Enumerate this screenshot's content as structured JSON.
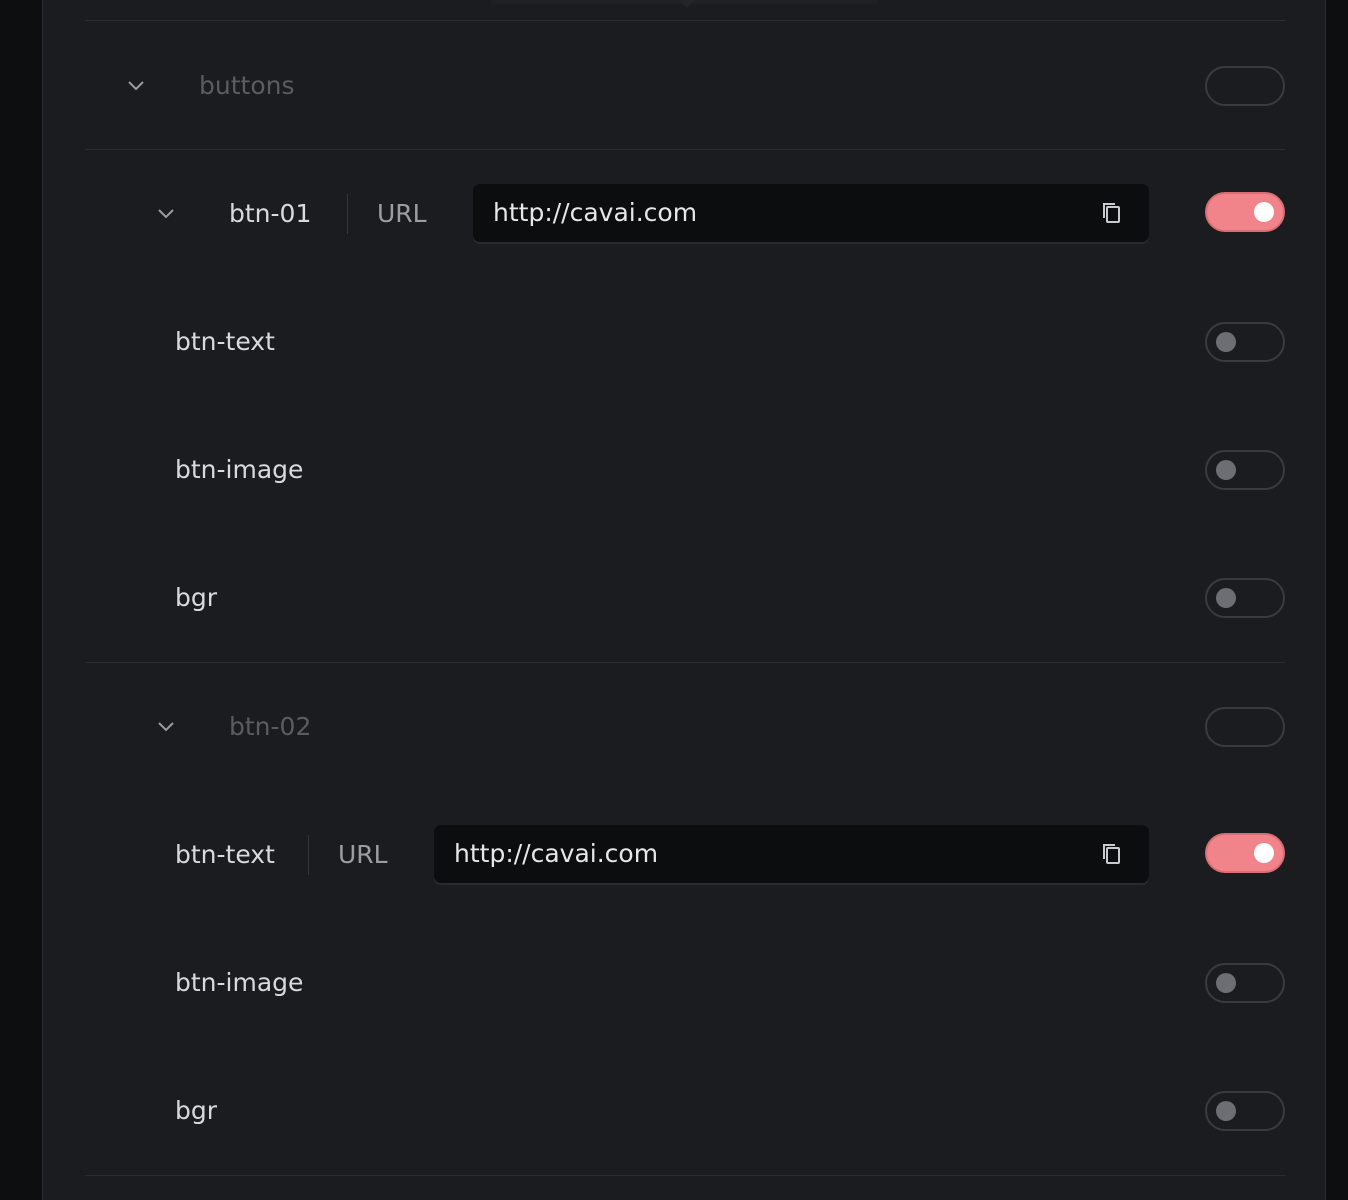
{
  "sections": [
    {
      "title": "buttons",
      "enabled": null,
      "groups": [
        {
          "name": "btn-01",
          "url_label": "URL",
          "url_value": "http://cavai.com",
          "enabled": true,
          "items": [
            {
              "name": "btn-text",
              "enabled": false
            },
            {
              "name": "btn-image",
              "enabled": false
            },
            {
              "name": "bgr",
              "enabled": false
            }
          ]
        },
        {
          "name": "btn-02",
          "enabled": null,
          "items": [
            {
              "name": "btn-text",
              "url_label": "URL",
              "url_value": "http://cavai.com",
              "enabled": true
            },
            {
              "name": "btn-image",
              "enabled": false
            },
            {
              "name": "bgr",
              "enabled": false
            }
          ]
        }
      ]
    }
  ],
  "colors": {
    "panel_bg": "#1b1c1f",
    "toggle_on": "#f1848a",
    "field_bg": "#0c0d0f"
  },
  "icons": {
    "expand": "chevron-down-icon",
    "copy": "copy-icon"
  }
}
